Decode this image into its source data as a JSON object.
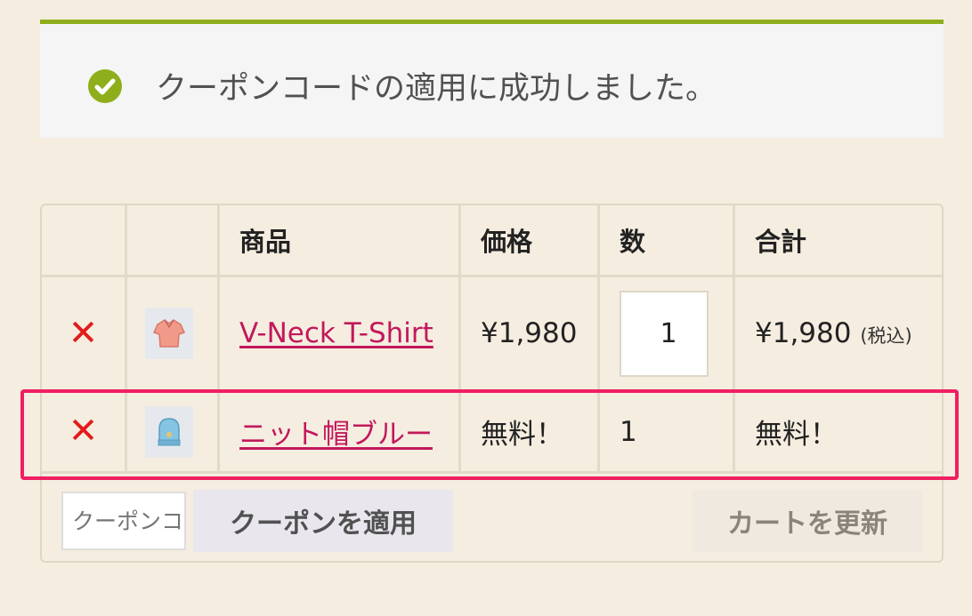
{
  "notice": {
    "icon": "check-circle-icon",
    "icon_color": "#8fae1b",
    "message": "クーポンコードの適用に成功しました。"
  },
  "cart": {
    "headers": {
      "product": "商品",
      "price": "価格",
      "quantity": "数",
      "subtotal": "合計"
    },
    "rows": [
      {
        "remove_icon": "close-icon",
        "thumbnail": "t-shirt-icon",
        "name": "V-Neck T-Shirt",
        "price": "¥1,980",
        "quantity": "1",
        "subtotal": "¥1,980",
        "tax_note": "(税込)"
      },
      {
        "remove_icon": "close-icon",
        "thumbnail": "knit-hat-icon",
        "name": "ニット帽ブルー",
        "price": "無料！",
        "quantity": "1",
        "subtotal": "無料！"
      }
    ],
    "coupon_placeholder": "クーポンコード",
    "apply_coupon_label": "クーポンを適用",
    "update_cart_label": "カートを更新"
  },
  "colors": {
    "accent_link": "#c2185b",
    "remove": "#e31b1b",
    "highlight": "#ef1f62",
    "success": "#8fae1b"
  }
}
